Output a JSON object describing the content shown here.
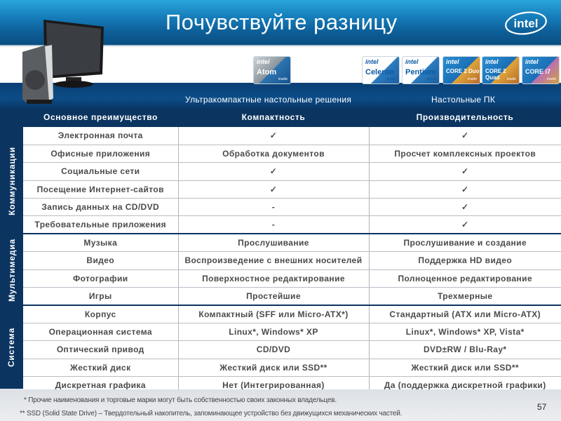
{
  "header": {
    "title": "Почувствуйте разницу",
    "brand": "intel"
  },
  "badges": [
    {
      "brand": "intel",
      "name": "Atom",
      "tag": "inside",
      "style": "atom"
    },
    {
      "brand": "intel",
      "name": "Celeron",
      "tag": "inside",
      "style": "white"
    },
    {
      "brand": "intel",
      "name": "Pentium",
      "tag": "inside",
      "style": "white"
    },
    {
      "brand": "intel",
      "name": "CORE 2 Duo",
      "tag": "inside",
      "style": "core"
    },
    {
      "brand": "intel",
      "name": "CORE 2 Quad",
      "tag": "inside",
      "style": "core"
    },
    {
      "brand": "intel",
      "name": "CORE i7",
      "tag": "inside",
      "style": "i7"
    }
  ],
  "segments": {
    "ultracompact": "Ультракомпактные настольные решения",
    "desktop": "Настольные ПК"
  },
  "table": {
    "headers": [
      "Основное преимущество",
      "Компактность",
      "Производительность"
    ],
    "groups": [
      {
        "label": "Коммуникации",
        "rows": [
          [
            "Электронная почта",
            "✓",
            "✓"
          ],
          [
            "Офисные приложения",
            "Обработка документов",
            "Просчет комплексных проектов"
          ],
          [
            "Социальные сети",
            "✓",
            "✓"
          ],
          [
            "Посещение Интернет-сайтов",
            "✓",
            "✓"
          ],
          [
            "Запись данных на CD/DVD",
            "-",
            "✓"
          ],
          [
            "Требовательные приложения",
            "-",
            "✓"
          ]
        ]
      },
      {
        "label": "Мультимедиа",
        "rows": [
          [
            "Музыка",
            "Прослушивание",
            "Прослушивание и создание"
          ],
          [
            "Видео",
            "Воспроизведение с внешних носителей",
            "Поддержка HD видео"
          ],
          [
            "Фотографии",
            "Поверхностное редактирование",
            "Полноценное редактирование"
          ],
          [
            "Игры",
            "Простейшие",
            "Трехмерные"
          ]
        ]
      },
      {
        "label": "Система",
        "rows": [
          [
            "Корпус",
            "Компактный (SFF или Micro-ATX*)",
            "Стандартный (ATX или Micro-ATX)"
          ],
          [
            "Операционная система",
            "Linux*, Windows* XP",
            "Linux*, Windows* XP, Vista*"
          ],
          [
            "Оптический привод",
            "CD/DVD",
            "DVD±RW / Blu-Ray*"
          ],
          [
            "Жесткий диск",
            "Жесткий диск или SSD**",
            "Жесткий диск или SSD**"
          ],
          [
            "Дискретная графика",
            "Нет (Интегрированная)",
            "Да (поддержка дискретной графики)"
          ]
        ]
      }
    ]
  },
  "footnotes": [
    "*  Прочие наименования и торговые марки могут быть собственностью своих законных владельцев.",
    "**  SSD (Solid State Drive) – Твердотельный накопитель, запоминающее устройство без движущихся механических частей."
  ],
  "page_number": "57"
}
